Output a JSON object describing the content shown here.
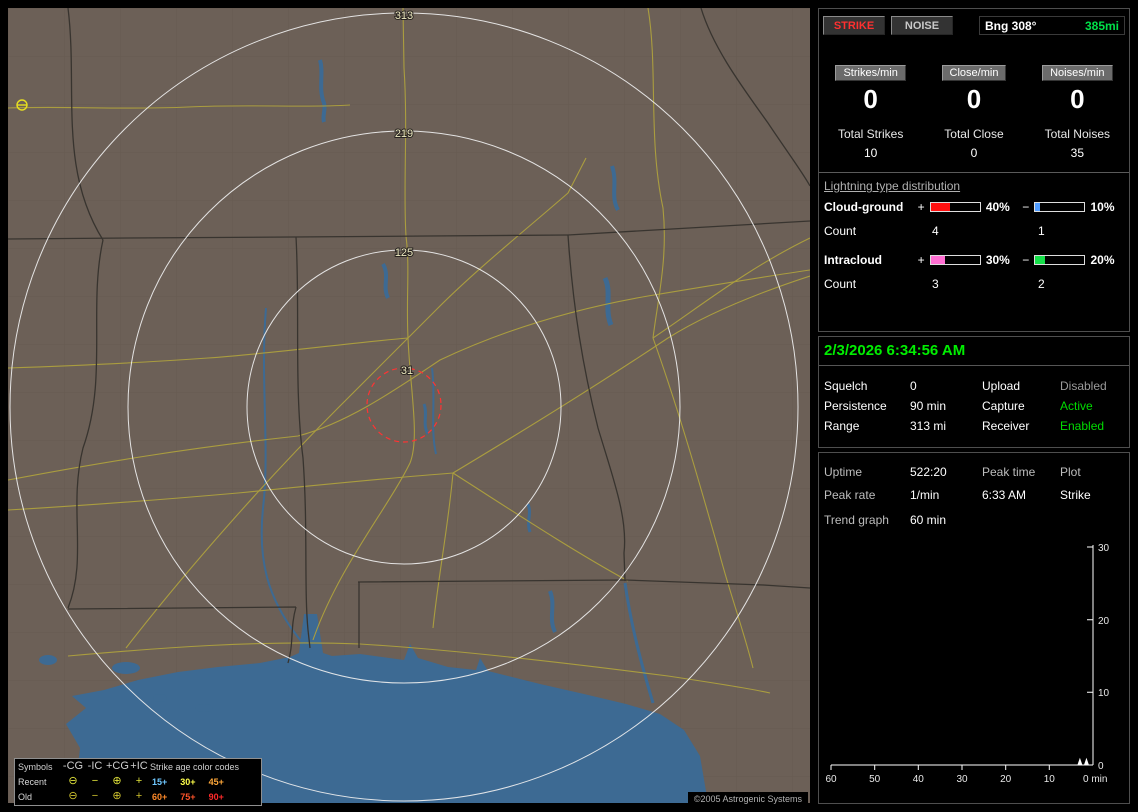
{
  "map": {
    "rings": [
      {
        "label": "313"
      },
      {
        "label": "219"
      },
      {
        "label": "125"
      },
      {
        "label": "31"
      }
    ],
    "copyright": "©2005 Astrogenic Systems",
    "legend": {
      "header": {
        "symbols": "Symbols",
        "cg_neg": "-CG",
        "ic_neg": "-IC",
        "cg_pos": "+CG",
        "ic_pos": "+IC",
        "age_title": "Strike age color codes"
      },
      "symbols": {
        "cg_neg": "⊖",
        "ic_neg": "−",
        "cg_pos": "⊕",
        "ic_pos": "+"
      },
      "rows": [
        {
          "label": "Recent",
          "symbol_color": "#e0e23a",
          "ages": [
            {
              "label": "15+",
              "color": "#6fc8ff"
            },
            {
              "label": "30+",
              "color": "#ffff4a"
            },
            {
              "label": "45+",
              "color": "#ffa83a"
            }
          ]
        },
        {
          "label": "Old",
          "symbol_color": "#cfc22e",
          "ages": [
            {
              "label": "60+",
              "color": "#ff8a2a"
            },
            {
              "label": "75+",
              "color": "#ff542a"
            },
            {
              "label": "90+",
              "color": "#ff2a2a"
            }
          ]
        }
      ]
    }
  },
  "panel": {
    "strike_button": {
      "label": "STRIKE",
      "color": "#ff3030"
    },
    "noise_button": {
      "label": "NOISE",
      "color": "#c8c8c8"
    },
    "bearing": {
      "label": "Bng 308°",
      "range": "385mi",
      "range_color": "#00e048"
    },
    "rates": [
      {
        "label": "Strikes/min",
        "value": "0"
      },
      {
        "label": "Close/min",
        "value": "0"
      },
      {
        "label": "Noises/min",
        "value": "0"
      }
    ],
    "totals": [
      {
        "label": "Total Strikes",
        "value": "10"
      },
      {
        "label": "Total Close",
        "value": "0"
      },
      {
        "label": "Total Noises",
        "value": "35"
      }
    ],
    "distribution": {
      "title": "Lightning type distribution",
      "rows": [
        {
          "label": "Cloud-ground",
          "plus_sign": "+",
          "minus_sign": "−",
          "count_label": "Count",
          "pos": {
            "pct": 40,
            "pct_label": "40%",
            "color": "#ff1010",
            "count": "4"
          },
          "neg": {
            "pct": 10,
            "pct_label": "10%",
            "color": "#4f9cff",
            "count": "1"
          }
        },
        {
          "label": "Intracloud",
          "plus_sign": "+",
          "minus_sign": "−",
          "count_label": "Count",
          "pos": {
            "pct": 30,
            "pct_label": "30%",
            "color": "#ff6ed2",
            "count": "3"
          },
          "neg": {
            "pct": 20,
            "pct_label": "20%",
            "color": "#16e04a",
            "count": "2"
          }
        }
      ]
    },
    "status": {
      "datetime": "2/3/2026 6:34:56 AM",
      "datetime_color": "#00ee00",
      "rows": [
        {
          "k1": "Squelch",
          "v1": "0",
          "k2": "Upload",
          "v2": "Disabled",
          "v2_color": "#9a9a9a"
        },
        {
          "k1": "Persistence",
          "v1": "90 min",
          "k2": "Capture",
          "v2": "Active",
          "v2_color": "#00dd00"
        },
        {
          "k1": "Range",
          "v1": "313 mi",
          "k2": "Receiver",
          "v2": "Enabled",
          "v2_color": "#00dd00"
        }
      ]
    },
    "stats": {
      "row1": {
        "k1": "Uptime",
        "v1": "522:20",
        "k2": "Peak time",
        "k3": "Plot"
      },
      "row2": {
        "k1": "Peak rate",
        "v1": "1/min",
        "v2": "6:33 AM",
        "v3": "Strike"
      },
      "trend_label": "Trend graph",
      "trend_value": "60 min"
    }
  },
  "chart_data": {
    "type": "bar",
    "title": "Trend graph (60 min)",
    "xlabel": "min",
    "x_tick_labels": [
      "60",
      "50",
      "40",
      "30",
      "20",
      "10",
      "0 min"
    ],
    "y_tick_labels": [
      "30",
      "20",
      "10",
      "0"
    ],
    "ylim": [
      0,
      30
    ],
    "x_minutes_range": [
      60,
      0
    ],
    "grid": false,
    "legend_position": "none",
    "axis_color": "#ffffff",
    "series": [
      {
        "name": "Strike",
        "points": [
          {
            "minutes_ago": 3,
            "value": 1
          },
          {
            "minutes_ago": 1.5,
            "value": 1
          }
        ]
      }
    ]
  }
}
